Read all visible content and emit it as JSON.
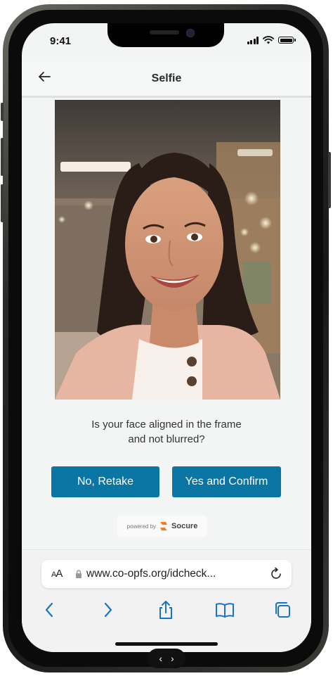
{
  "status_bar": {
    "time": "9:41"
  },
  "header": {
    "title": "Selfie"
  },
  "selfie": {
    "description_alt": ""
  },
  "prompt": {
    "line1": "Is your face aligned in the frame",
    "line2": "and not blurred?"
  },
  "actions": {
    "retake_label": "No, Retake",
    "confirm_label": "Yes and Confirm"
  },
  "powered_by": {
    "prefix": "powered by",
    "brand": "Socure"
  },
  "browser": {
    "aa_label": "AA",
    "url": "www.co-opfs.org/idcheck..."
  },
  "nav_pill": {
    "prev": "‹",
    "next": "›"
  },
  "colors": {
    "accent": "#0b76a4",
    "socure_orange": "#f47d20",
    "ios_blue": "#1a73c9"
  },
  "icons": {
    "back": "arrow-left-icon",
    "lock": "lock-icon",
    "reload": "reload-icon",
    "browser_back": "chevron-left-icon",
    "browser_forward": "chevron-right-icon",
    "share": "share-icon",
    "bookmarks": "book-icon",
    "tabs": "tabs-icon"
  }
}
